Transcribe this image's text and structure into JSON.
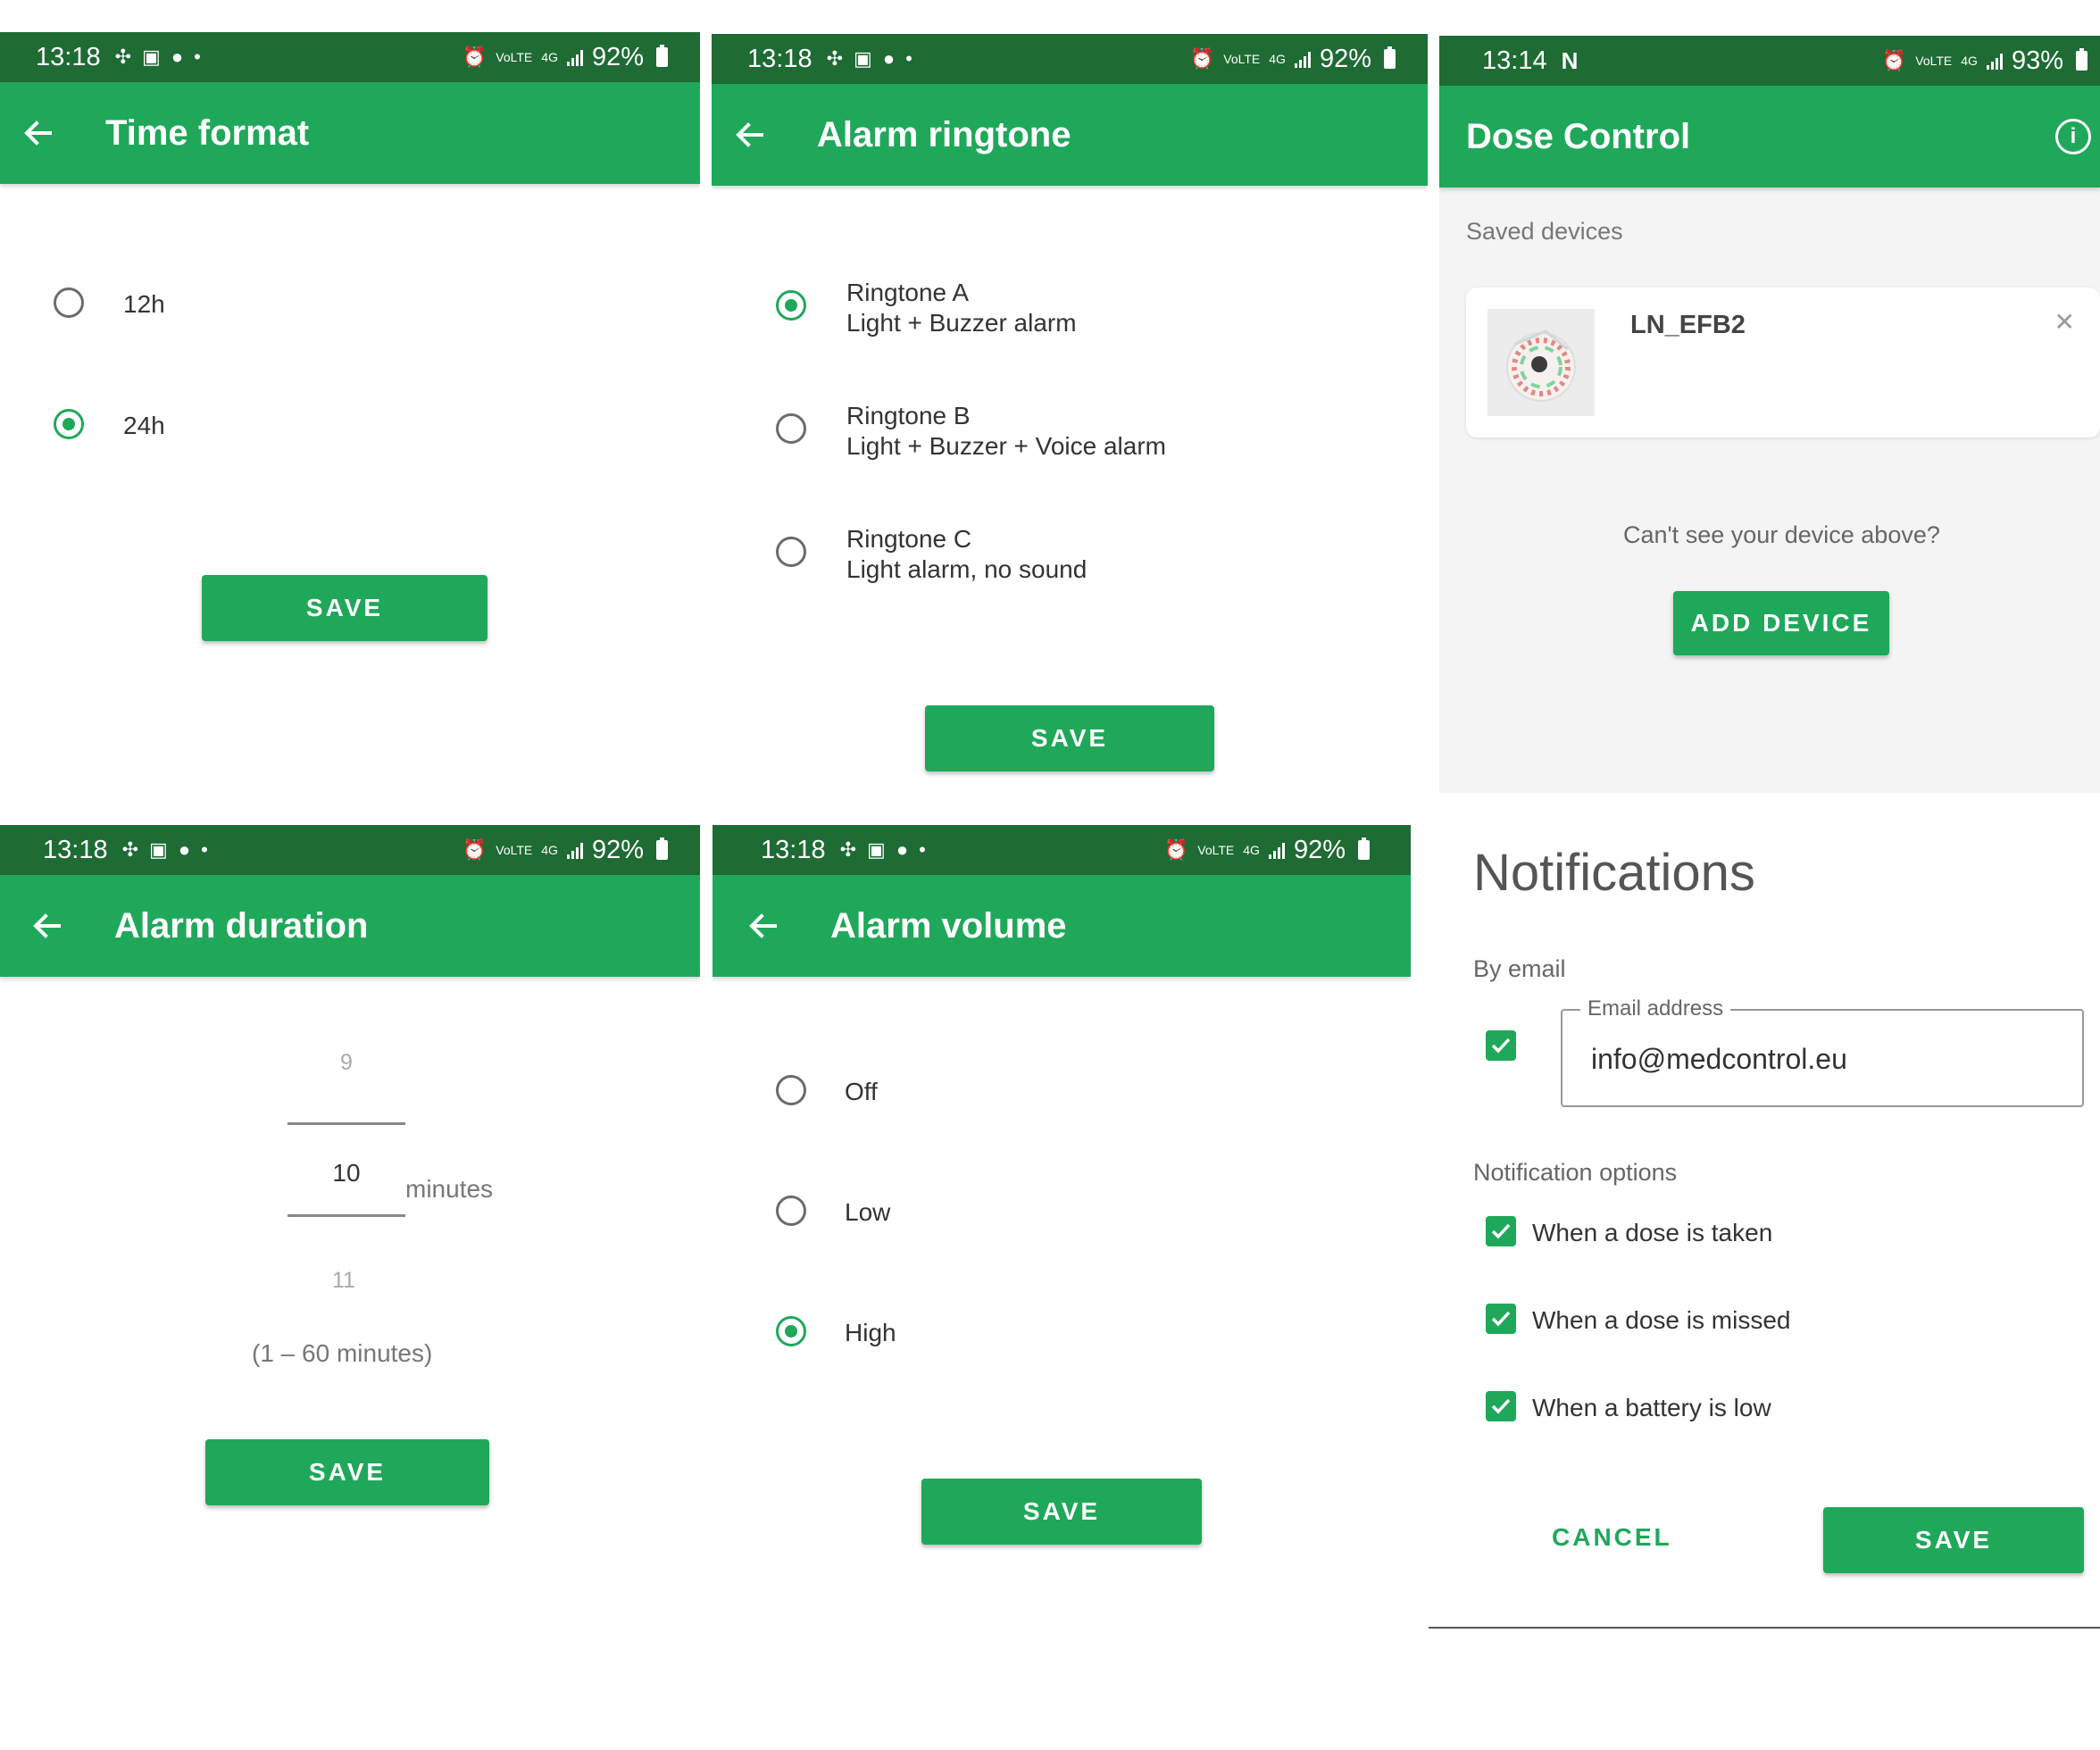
{
  "status": {
    "time_a": "13:18",
    "time_b": "13:14",
    "battery_92": "92%",
    "battery_93": "93%"
  },
  "time_format": {
    "title": "Time format",
    "options": [
      {
        "label": "12h",
        "selected": false
      },
      {
        "label": "24h",
        "selected": true
      }
    ],
    "save": "SAVE"
  },
  "alarm_ringtone": {
    "title": "Alarm ringtone",
    "options": [
      {
        "name": "Ringtone A",
        "desc": "Light + Buzzer alarm",
        "selected": true
      },
      {
        "name": "Ringtone B",
        "desc": "Light + Buzzer + Voice alarm",
        "selected": false
      },
      {
        "name": "Ringtone C",
        "desc": "Light alarm, no sound",
        "selected": false
      }
    ],
    "save": "SAVE"
  },
  "dose_control": {
    "title": "Dose Control",
    "saved_devices_label": "Saved devices",
    "device_name": "LN_EFB2",
    "cant_see": "Can't see your device above?",
    "add_device": "ADD DEVICE"
  },
  "alarm_duration": {
    "title": "Alarm duration",
    "prev": "9",
    "current": "10",
    "next": "11",
    "unit": "minutes",
    "range": "(1 – 60 minutes)",
    "save": "SAVE"
  },
  "alarm_volume": {
    "title": "Alarm volume",
    "options": [
      {
        "label": "Off",
        "selected": false
      },
      {
        "label": "Low",
        "selected": false
      },
      {
        "label": "High",
        "selected": true
      }
    ],
    "save": "SAVE"
  },
  "notifications": {
    "title": "Notifications",
    "by_email": "By email",
    "email_label": "Email address",
    "email_value": "info@medcontrol.eu",
    "options_label": "Notification options",
    "options": [
      {
        "label": "When a dose is taken",
        "checked": true
      },
      {
        "label": "When a dose is missed",
        "checked": true
      },
      {
        "label": "When a battery is low",
        "checked": true
      }
    ],
    "cancel": "CANCEL",
    "save": "SAVE"
  },
  "colors": {
    "status_bar": "#1e6b34",
    "app_bar": "#1fa85a",
    "accent": "#1fa85a"
  }
}
